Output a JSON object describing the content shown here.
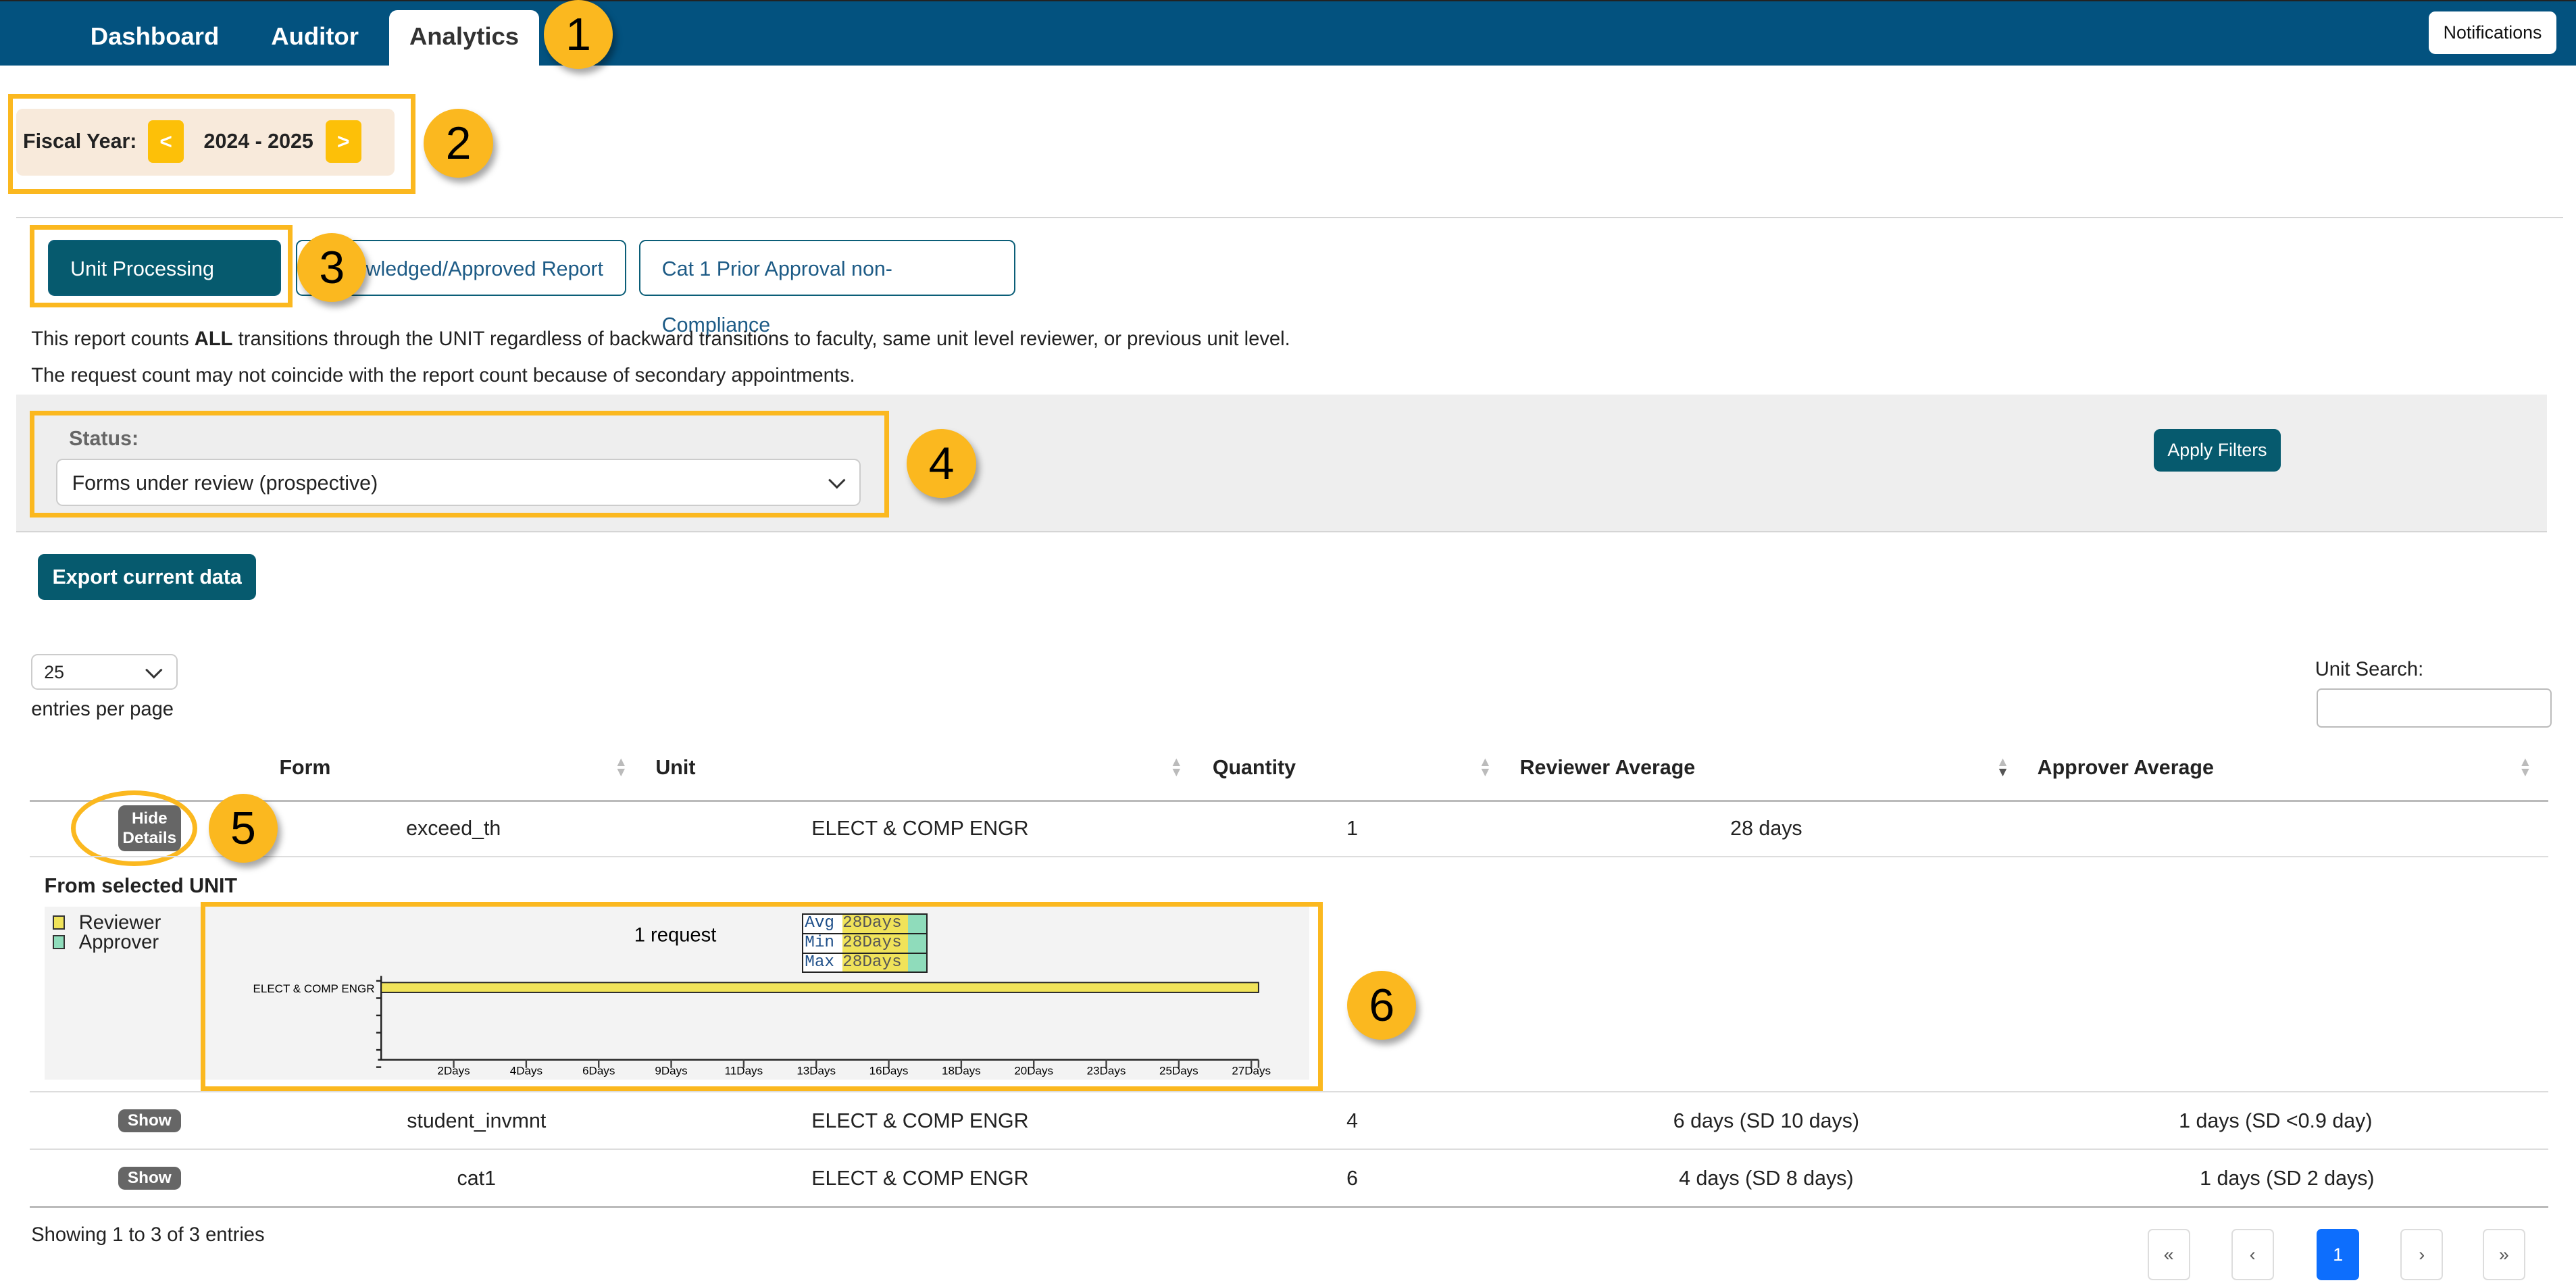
{
  "nav": {
    "tabs": [
      {
        "label": "Dashboard"
      },
      {
        "label": "Auditor"
      },
      {
        "label": "Analytics",
        "active": true
      }
    ],
    "notifications_label": "Notifications",
    "brand_color": "#03527f"
  },
  "fiscal_year": {
    "label": "Fiscal Year:",
    "value": "2024 - 2025",
    "prev": "<",
    "next": ">"
  },
  "report_tabs": [
    {
      "label": "Unit Processing Time",
      "active": true
    },
    {
      "label": "wledged/Approved Report"
    },
    {
      "label": "Cat 1 Prior Approval non-Compliance"
    }
  ],
  "notes": {
    "line1_pre": "This report counts ",
    "line1_bold": "ALL",
    "line1_post": " transitions through the UNIT regardless of backward transitions to faculty, same unit level reviewer, or previous unit level.",
    "line2": "The request count may not coincide with the report count because of secondary appointments."
  },
  "filters": {
    "status_label": "Status:",
    "status_value": "Forms under review (prospective)",
    "apply_label": "Apply Filters"
  },
  "export_label": "Export current data",
  "page_size": {
    "value": "25",
    "label": "entries per page"
  },
  "unit_search": {
    "label": "Unit Search:",
    "value": ""
  },
  "table": {
    "headers": [
      "Form",
      "Unit",
      "Quantity",
      "Reviewer Average",
      "Approver Average"
    ],
    "sorted_column": "Reviewer Average",
    "rows": [
      {
        "button": "Hide Details",
        "form": "exceed_th",
        "unit": "ELECT & COMP ENGR",
        "quantity": "1",
        "reviewer_avg": "28 days",
        "approver_avg": ""
      },
      {
        "button": "Show",
        "form": "student_invmnt",
        "unit": "ELECT & COMP ENGR",
        "quantity": "4",
        "reviewer_avg": "6 days (SD 10 days)",
        "approver_avg": "1 days (SD <0.9 day)"
      },
      {
        "button": "Show",
        "form": "cat1",
        "unit": "ELECT & COMP ENGR",
        "quantity": "6",
        "reviewer_avg": "4 days (SD 8 days)",
        "approver_avg": "1 days (SD 2 days)"
      }
    ]
  },
  "details": {
    "title": "From selected UNIT",
    "legend": [
      {
        "label": "Reviewer",
        "color": "#f0e35a"
      },
      {
        "label": "Approver",
        "color": "#8fdcbb"
      }
    ]
  },
  "chart_data": {
    "type": "bar",
    "orientation": "horizontal",
    "title": "1 request",
    "categories": [
      "ELECT & COMP ENGR"
    ],
    "series": [
      {
        "name": "Reviewer",
        "values": [
          28
        ],
        "color": "#f0e35a"
      }
    ],
    "x_tick_labels": [
      "2Days",
      "4Days",
      "6Days",
      "9Days",
      "11Days",
      "13Days",
      "16Days",
      "18Days",
      "20Days",
      "23Days",
      "25Days",
      "27Days"
    ],
    "xlim": [
      0,
      28
    ],
    "stats": [
      {
        "label": "Avg",
        "value": "28Days"
      },
      {
        "label": "Min",
        "value": "28Days"
      },
      {
        "label": "Max",
        "value": "28Days"
      }
    ]
  },
  "footer": {
    "info": "Showing 1 to 3 of 3 entries",
    "pagination": [
      "«",
      "‹",
      "1",
      "›",
      "»"
    ],
    "current_page": "1"
  },
  "annotations": [
    "1",
    "2",
    "3",
    "4",
    "5",
    "6"
  ]
}
